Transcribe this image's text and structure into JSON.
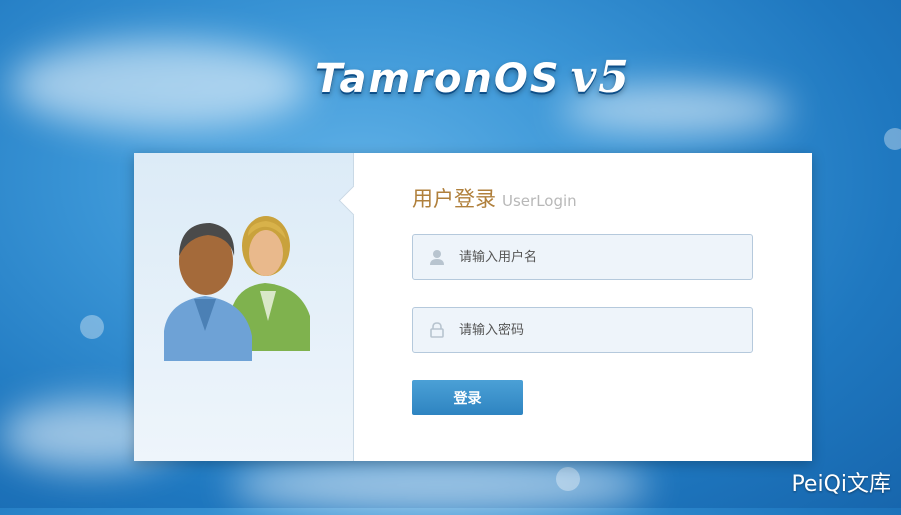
{
  "brand": {
    "name": "TamronOS",
    "version": "v5"
  },
  "login": {
    "title": "用户登录",
    "subtitle": "UserLogin",
    "username_placeholder": "请输入用户名",
    "password_placeholder": "请输入密码",
    "submit_label": "登录"
  },
  "watermark": "PeiQi文库",
  "colors": {
    "title": "#b0803c",
    "button": "#3a8fcb",
    "field_bg": "#eef4fa"
  },
  "icons": {
    "username": "user-icon",
    "password": "lock-icon",
    "illustration": "users-icon"
  }
}
